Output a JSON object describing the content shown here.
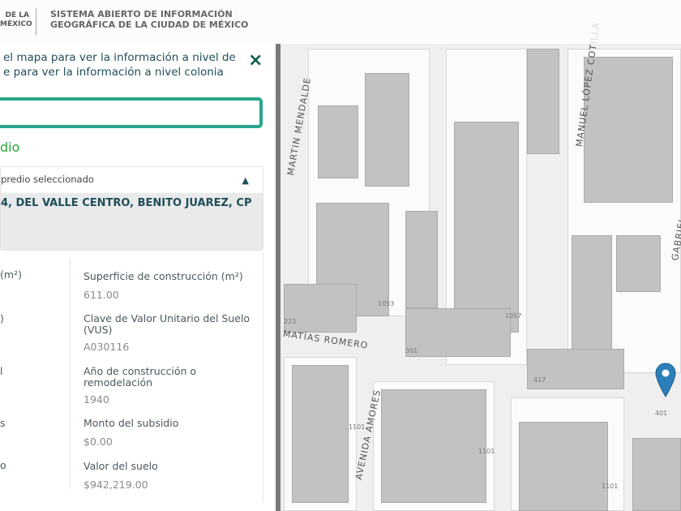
{
  "header": {
    "logo_line1": "DE LA",
    "logo_line2": "MÉXICO",
    "title_line1": "SISTEMA ABIERTO DE INFORMACIÓN",
    "title_line2": "GEOGRÁFICA DE LA CIUDAD DE MÉXICO"
  },
  "panel": {
    "instruction_line1": "el mapa para ver la información a nivel de",
    "instruction_line2": "e para ver la información a nivel colonia",
    "close_icon": "×",
    "search_value": "",
    "section_title": "dio",
    "accordion_title": "predio seleccionado",
    "address": "4, DEL VALLE CENTRO, BENITO JUAREZ, CP",
    "left_labels": [
      "(m²)",
      ")",
      "l",
      "s",
      "o"
    ],
    "fields": [
      {
        "label": "Superficie de construcción (m²)",
        "value": "611.00"
      },
      {
        "label": "Clave de Valor Unitario del Suelo (VUS)",
        "value": "A030116"
      },
      {
        "label": "Año de construcción o remodelación",
        "value": "1940"
      },
      {
        "label": "Monto del subsidio",
        "value": "$0.00"
      },
      {
        "label": "Valor del suelo",
        "value": "$942,219.00"
      }
    ]
  },
  "map": {
    "streets": [
      "MARTIN MENDALDE",
      "MANUEL LÓPEZ COTILLA",
      "MATÍAS ROMERO",
      "AVENIDA AMORES",
      "GABRIEL"
    ],
    "numbers": [
      "1053",
      "1057",
      "301",
      "417",
      "223",
      "1101",
      "1101",
      "401",
      "1101"
    ],
    "pin_color": "#2c7fb8"
  }
}
